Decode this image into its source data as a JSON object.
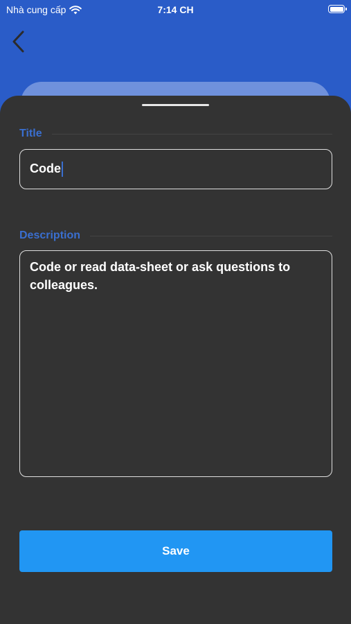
{
  "status_bar": {
    "carrier": "Nhà cung cấp",
    "time": "7:14 CH"
  },
  "form": {
    "title_label": "Title",
    "title_value": "Code",
    "description_label": "Description",
    "description_value": "Code or read data-sheet or ask questions to colleagues.",
    "save_label": "Save"
  },
  "colors": {
    "header": "#2a5cc8",
    "sheet": "#333333",
    "accent_label": "#3a6fd0",
    "save_button": "#2196f3"
  }
}
